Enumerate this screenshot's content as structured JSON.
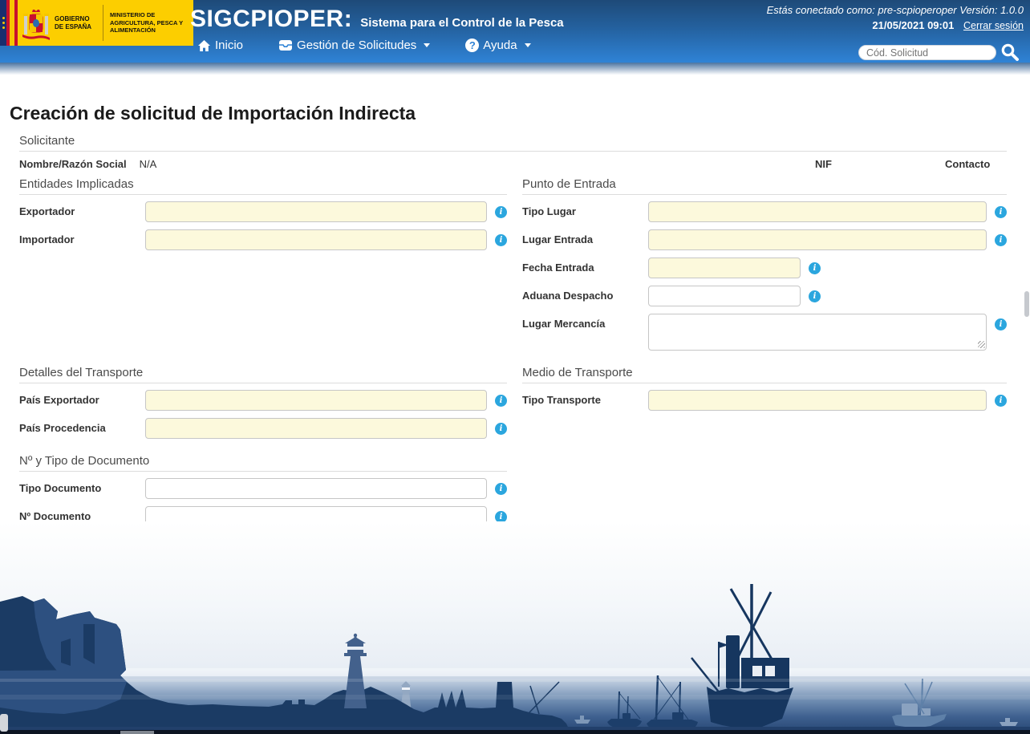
{
  "header": {
    "government_label": "Gobierno de España",
    "ministry_label": "Ministerio de Agricultura, Pesca y Alimentación",
    "app_name": "SIGCPIOPER:",
    "app_tagline": "Sistema para el Control de la Pesca",
    "session_text": "Estás conectado como: pre-scpioperoper Versión: 1.0.0",
    "datetime": "21/05/2021 09:01",
    "logout_label": "Cerrar sesión",
    "nav": [
      {
        "label": "Inicio",
        "icon": "home-icon"
      },
      {
        "label": "Gestión de Solicitudes",
        "icon": "inbox-icon",
        "has_dropdown": true
      },
      {
        "label": "Ayuda",
        "icon": "help-icon",
        "has_dropdown": true
      }
    ],
    "search": {
      "placeholder": "Cód. Solicitud",
      "icon": "search-icon"
    }
  },
  "form": {
    "title": "Creación de solicitud de Importación Indirecta",
    "solicitante": {
      "heading": "Solicitante",
      "nombre_label": "Nombre/Razón Social",
      "nombre_value": "N/A",
      "nif_label": "NIF",
      "contacto_label": "Contacto"
    },
    "entidades": {
      "heading": "Entidades Implicadas",
      "exportador_label": "Exportador",
      "exportador_value": "",
      "importador_label": "Importador",
      "importador_value": ""
    },
    "punto_entrada": {
      "heading": "Punto de Entrada",
      "tipo_lugar_label": "Tipo Lugar",
      "tipo_lugar_value": "",
      "lugar_entrada_label": "Lugar Entrada",
      "lugar_entrada_value": "",
      "fecha_entrada_label": "Fecha Entrada",
      "fecha_entrada_value": "",
      "aduana_label": "Aduana Despacho",
      "aduana_value": "",
      "lugar_mercancia_label": "Lugar Mercancía",
      "lugar_mercancia_value": ""
    },
    "detalles_transporte": {
      "heading": "Detalles del Transporte",
      "pais_exportador_label": "País Exportador",
      "pais_exportador_value": "",
      "pais_procedencia_label": "País Procedencia",
      "pais_procedencia_value": ""
    },
    "medio_transporte": {
      "heading": "Medio de Transporte",
      "tipo_transporte_label": "Tipo Transporte",
      "tipo_transporte_value": ""
    },
    "documento": {
      "heading": "Nº y Tipo de Documento",
      "tipo_documento_label": "Tipo Documento",
      "tipo_documento_value": "",
      "num_documento_label": "Nº Documento",
      "num_documento_value": ""
    }
  },
  "colors": {
    "header_blue_top": "#1E4A78",
    "header_blue_bottom": "#2F83D6",
    "logo_yellow": "#FCCE00",
    "required_field_bg": "#FCF9DC",
    "info_icon_blue": "#2BA6DE",
    "illustration_navy_dark": "#1B3B64",
    "illustration_navy_deep": "#16365F",
    "illustration_slate": "#43618C",
    "sea_deep": "#2B4B78"
  }
}
